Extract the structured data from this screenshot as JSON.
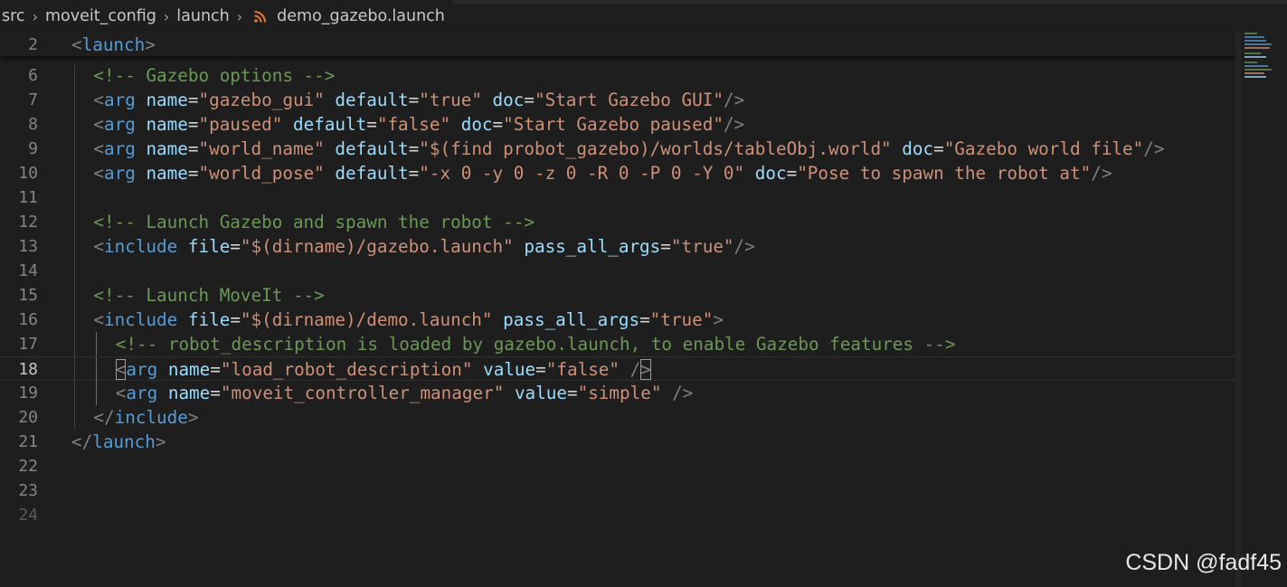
{
  "breadcrumb": {
    "items": [
      "src",
      "moveit_config",
      "launch"
    ],
    "file": "demo_gazebo.launch",
    "file_icon": "rss-icon",
    "file_icon_color": "#e37933"
  },
  "sticky": {
    "line_number": "2",
    "tag": "launch"
  },
  "lines": [
    {
      "n": "6",
      "text": "<!-- Gazebo options -->"
    },
    {
      "n": "7",
      "text": "<arg name=\"gazebo_gui\" default=\"true\" doc=\"Start Gazebo GUI\"/>"
    },
    {
      "n": "8",
      "text": "<arg name=\"paused\" default=\"false\" doc=\"Start Gazebo paused\"/>"
    },
    {
      "n": "9",
      "text": "<arg name=\"world_name\" default=\"$(find probot_gazebo)/worlds/tableObj.world\" doc=\"Gazebo world file\"/>"
    },
    {
      "n": "10",
      "text": "<arg name=\"world_pose\" default=\"-x 0 -y 0 -z 0 -R 0 -P 0 -Y 0\" doc=\"Pose to spawn the robot at\"/>"
    },
    {
      "n": "11",
      "text": ""
    },
    {
      "n": "12",
      "text": "<!-- Launch Gazebo and spawn the robot -->"
    },
    {
      "n": "13",
      "text": "<include file=\"$(dirname)/gazebo.launch\" pass_all_args=\"true\"/>"
    },
    {
      "n": "14",
      "text": ""
    },
    {
      "n": "15",
      "text": "<!-- Launch MoveIt -->"
    },
    {
      "n": "16",
      "text": "<include file=\"$(dirname)/demo.launch\" pass_all_args=\"true\">"
    },
    {
      "n": "17",
      "text": "<!-- robot_description is loaded by gazebo.launch, to enable Gazebo features -->"
    },
    {
      "n": "18",
      "text": "<arg name=\"load_robot_description\" value=\"false\" />"
    },
    {
      "n": "19",
      "text": "<arg name=\"moveit_controller_manager\" value=\"simple\" />"
    },
    {
      "n": "20",
      "text": "</include>"
    },
    {
      "n": "21",
      "text": "</launch>"
    },
    {
      "n": "22",
      "text": ""
    },
    {
      "n": "23",
      "text": ""
    },
    {
      "n": "24",
      "text": ""
    }
  ],
  "active_line": "18",
  "watermark": "CSDN @fadf45",
  "colors": {
    "background": "#1e1e1e",
    "tag_bracket": "#808080",
    "tag_name": "#569cd6",
    "attribute": "#9cdcfe",
    "string": "#ce9178",
    "comment": "#6a9955"
  }
}
